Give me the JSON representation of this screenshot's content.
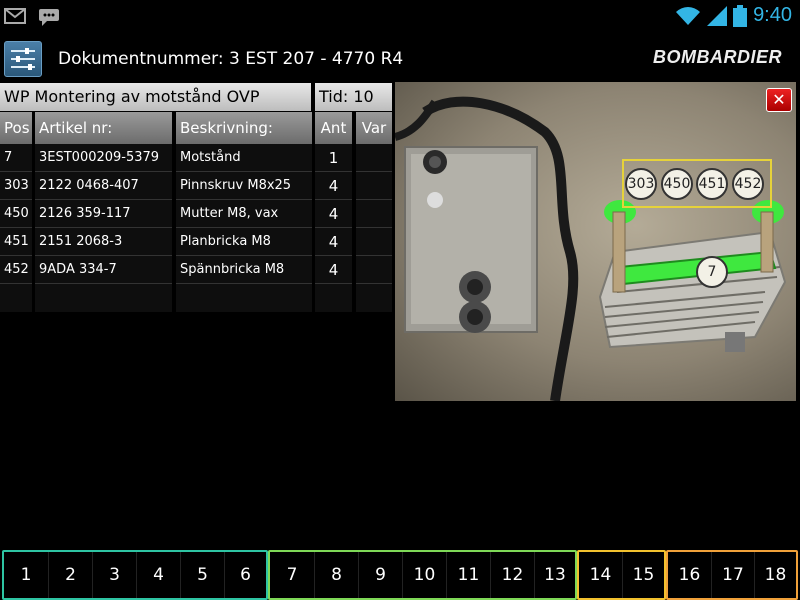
{
  "status_bar": {
    "time": "9:40",
    "icons": [
      "gmail-icon",
      "messaging-icon",
      "wifi-icon",
      "signal-icon",
      "battery-icon"
    ]
  },
  "header": {
    "document_label": "Dokumentnummer: 3 EST 207 - 4770 R4",
    "brand": "BOMBARDIER",
    "app_icon": "settings-sliders-icon"
  },
  "operation": {
    "title": "WP Montering av motstånd OVP",
    "time_label": "Tid: 10"
  },
  "parts_table": {
    "columns": [
      "Pos",
      "Artikel nr:",
      "Beskrivning:",
      "Ant",
      "Var"
    ],
    "rows": [
      {
        "pos": "7",
        "article": "3EST000209-5379",
        "description": "Motstånd",
        "qty": "1",
        "var": ""
      },
      {
        "pos": "303",
        "article": "2122 0468-407",
        "description": "Pinnskruv M8x25",
        "qty": "4",
        "var": ""
      },
      {
        "pos": "450",
        "article": "2126 359-117",
        "description": "Mutter M8, vax",
        "qty": "4",
        "var": ""
      },
      {
        "pos": "451",
        "article": "2151 2068-3",
        "description": "Planbricka M8",
        "qty": "4",
        "var": ""
      },
      {
        "pos": "452",
        "article": "9ADA 334-7",
        "description": "Spännbricka M8",
        "qty": "4",
        "var": ""
      }
    ]
  },
  "image": {
    "close_icon": "close-x-icon",
    "callouts_group": [
      "303",
      "450",
      "451",
      "452"
    ],
    "callout_single": "7",
    "highlight_color": "#3fe83f",
    "group_frame_color": "#e6d23a"
  },
  "step_groups": [
    {
      "color": "#2ec4a3",
      "steps": [
        "1",
        "2",
        "3",
        "4",
        "5",
        "6"
      ]
    },
    {
      "color": "#7ed957",
      "steps": [
        "7",
        "8",
        "9",
        "10",
        "11",
        "12",
        "13"
      ]
    },
    {
      "color": "#f2c12e",
      "steps": [
        "14",
        "15"
      ]
    },
    {
      "color": "#f0a13a",
      "steps": [
        "16",
        "17",
        "18"
      ]
    }
  ],
  "colors": {
    "clock": "#33b5e5",
    "close_button": "#cc1111"
  }
}
